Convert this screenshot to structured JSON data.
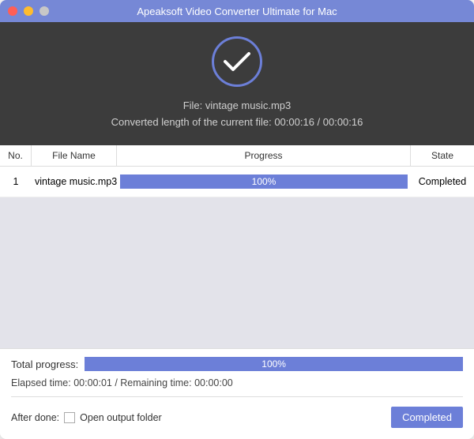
{
  "titlebar": {
    "title": "Apeaksoft Video Converter Ultimate for Mac"
  },
  "status": {
    "file_label_prefix": "File: ",
    "file_name": "vintage music.mp3",
    "converted_line": "Converted length of the current file: 00:00:16 / 00:00:16"
  },
  "table": {
    "headers": {
      "no": "No.",
      "name": "File Name",
      "progress": "Progress",
      "state": "State"
    },
    "rows": [
      {
        "no": "1",
        "name": "vintage music.mp3",
        "progress_pct": "100%",
        "state": "Completed"
      }
    ]
  },
  "bottom": {
    "total_label": "Total progress:",
    "total_pct": "100%",
    "elapsed_line": "Elapsed time: 00:00:01 / Remaining time: 00:00:00",
    "after_done_label": "After done:",
    "open_folder_label": "Open output folder",
    "completed_button": "Completed"
  }
}
